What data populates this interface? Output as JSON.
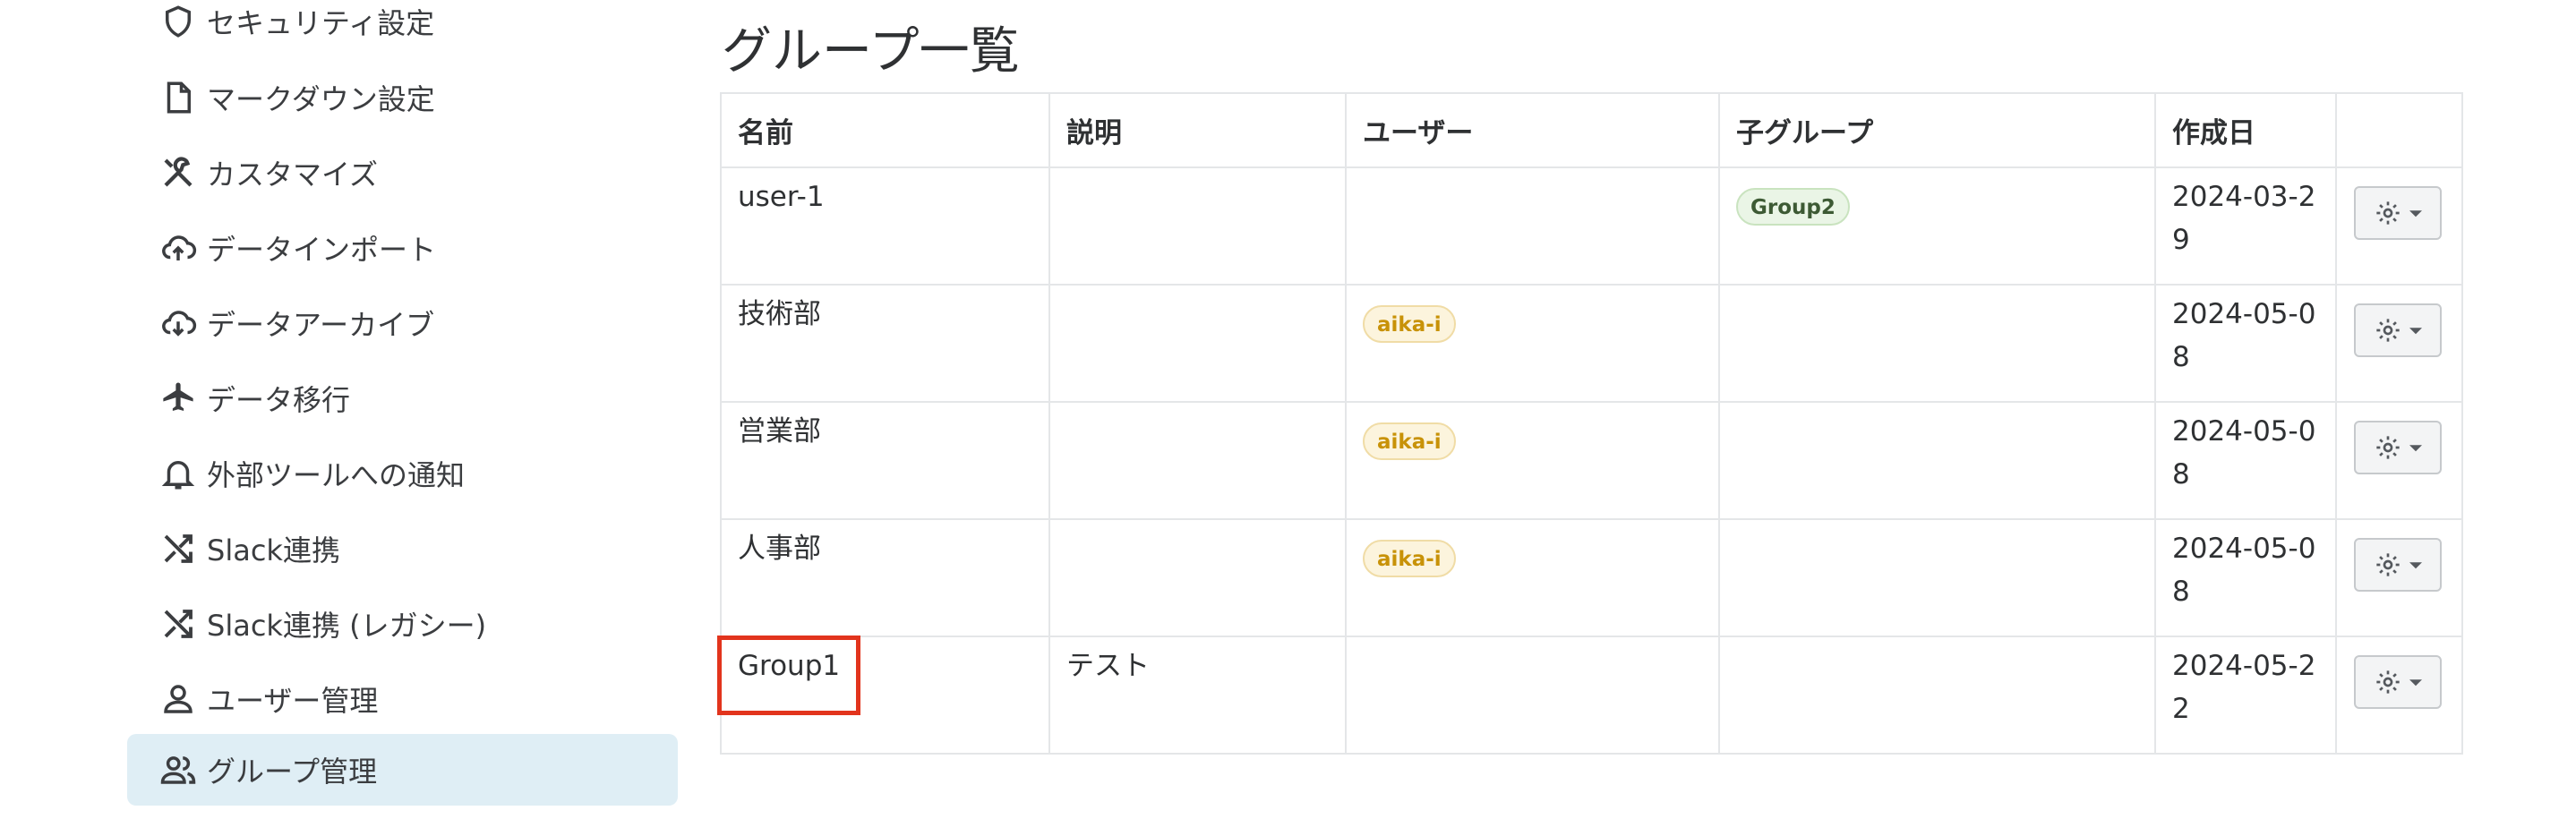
{
  "sidebar": {
    "items": [
      {
        "label": "セキュリティ設定",
        "icon": "shield-icon"
      },
      {
        "label": "マークダウン設定",
        "icon": "file-icon"
      },
      {
        "label": "カスタマイズ",
        "icon": "tools-icon"
      },
      {
        "label": "データインポート",
        "icon": "cloud-upload-icon"
      },
      {
        "label": "データアーカイブ",
        "icon": "cloud-download-icon"
      },
      {
        "label": "データ移行",
        "icon": "airplane-icon"
      },
      {
        "label": "外部ツールへの通知",
        "icon": "bell-icon"
      },
      {
        "label": "Slack連携",
        "icon": "shuffle-icon"
      },
      {
        "label": "Slack連携 (レガシー)",
        "icon": "shuffle-icon"
      },
      {
        "label": "ユーザー管理",
        "icon": "user-icon"
      },
      {
        "label": "グループ管理",
        "icon": "users-icon",
        "active": true
      }
    ]
  },
  "main": {
    "title": "グループ一覧",
    "table": {
      "headers": [
        "名前",
        "説明",
        "ユーザー",
        "子グループ",
        "作成日",
        ""
      ],
      "rows": [
        {
          "name": "user-1",
          "description": "",
          "user": "",
          "child_group": "Group2",
          "created": "2024-03-29"
        },
        {
          "name": "技術部",
          "description": "",
          "user": "aika-i",
          "child_group": "",
          "created": "2024-05-08"
        },
        {
          "name": "営業部",
          "description": "",
          "user": "aika-i",
          "child_group": "",
          "created": "2024-05-08"
        },
        {
          "name": "人事部",
          "description": "",
          "user": "aika-i",
          "child_group": "",
          "created": "2024-05-08"
        },
        {
          "name": "Group1",
          "description": "テスト",
          "user": "",
          "child_group": "",
          "created": "2024-05-22"
        }
      ]
    }
  },
  "colors": {
    "active_nav_bg": "#dfeef5",
    "user_badge": "#c89208",
    "group_badge": "#3d5a34",
    "highlight": "#e2341d"
  }
}
